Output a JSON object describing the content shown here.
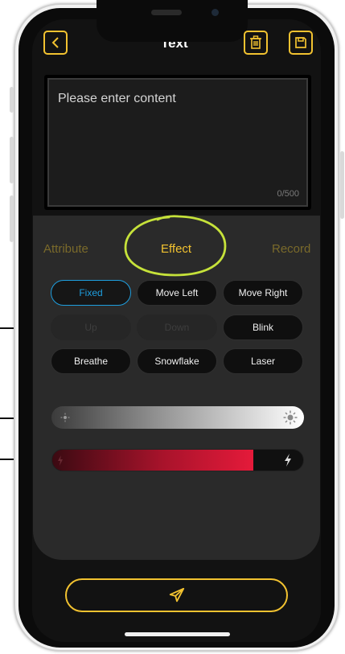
{
  "header": {
    "title": "Text",
    "back_icon": "chevron-left-icon",
    "delete_icon": "trash-icon",
    "save_icon": "floppy-disk-icon",
    "accent_color": "#f2c230"
  },
  "editor": {
    "placeholder": "Please enter content",
    "counter": "0/500"
  },
  "tabs": [
    {
      "label": "Attribute",
      "active": false
    },
    {
      "label": "Effect",
      "active": true
    },
    {
      "label": "Record",
      "active": false
    }
  ],
  "effects": [
    {
      "label": "Fixed",
      "state": "selected"
    },
    {
      "label": "Move Left",
      "state": "enabled"
    },
    {
      "label": "Move Right",
      "state": "enabled"
    },
    {
      "label": "Up",
      "state": "disabled"
    },
    {
      "label": "Down",
      "state": "disabled"
    },
    {
      "label": "Blink",
      "state": "enabled"
    },
    {
      "label": "Breathe",
      "state": "enabled"
    },
    {
      "label": "Snowflake",
      "state": "enabled"
    },
    {
      "label": "Laser",
      "state": "enabled"
    }
  ],
  "brightness": {
    "icon_low": "sun-small-icon",
    "icon_high": "sun-large-icon",
    "level": 1.0
  },
  "speed": {
    "icon_low": "lightning-icon",
    "icon_high": "lightning-icon",
    "level": 0.8,
    "color": "#e51a3a"
  },
  "bottom": {
    "send_icon": "paper-plane-icon"
  },
  "selection_color": "#1e9fe0",
  "annotation_color": "#c6e23a"
}
